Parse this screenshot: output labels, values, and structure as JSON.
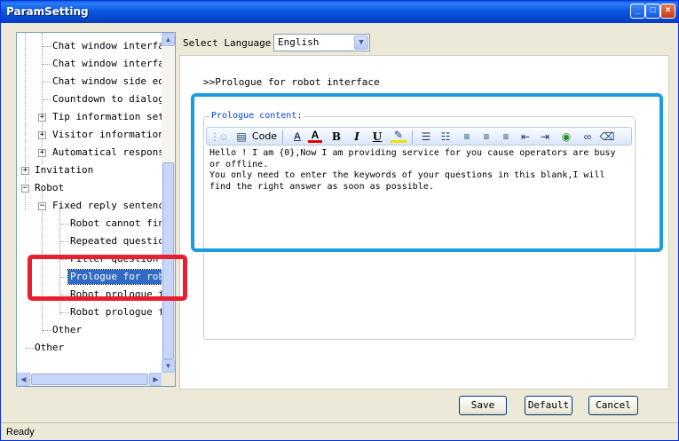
{
  "window": {
    "title": "ParamSetting",
    "buttons": {
      "minimize": "_",
      "maximize": "□",
      "close": "×"
    }
  },
  "tree": {
    "items": [
      {
        "label": "Chat window interface",
        "selected": false
      },
      {
        "label": "Chat window interface",
        "selected": false
      },
      {
        "label": "Chat window side edge",
        "selected": false
      },
      {
        "label": "Countdown to dialog",
        "selected": false
      },
      {
        "label": "Tip information settings",
        "selected": false
      },
      {
        "label": "Visitor information display",
        "selected": false
      },
      {
        "label": "Automatical response",
        "selected": false
      },
      {
        "label": "Invitation",
        "selected": false
      },
      {
        "label": "Robot",
        "selected": false
      },
      {
        "label": "Fixed reply sentences",
        "selected": false
      },
      {
        "label": "Robot cannot find answer",
        "selected": false
      },
      {
        "label": "Repeated question",
        "selected": false
      },
      {
        "label": "Filter question",
        "selected": false
      },
      {
        "label": "Prologue for robot interface",
        "selected": true
      },
      {
        "label": "Robot prologue for",
        "selected": false
      },
      {
        "label": "Robot prologue for",
        "selected": false
      },
      {
        "label": "Other",
        "selected": false
      },
      {
        "label": "Other",
        "selected": false
      }
    ]
  },
  "language": {
    "label": "Select Language",
    "value": "English"
  },
  "section_title": ">>Prologue for robot interface",
  "prologue": {
    "label": "Prologue content:",
    "toolbar": {
      "code_label": "Code",
      "bold": "B",
      "italic": "I",
      "underline": "U"
    },
    "content_line1": "Hello ! I am {0},Now I am providing service for you cause operators are busy or offline.",
    "content_line2": "You only need to enter the keywords of your questions in this blank,I will find the right answer as soon as possible."
  },
  "buttons": {
    "save": "Save",
    "default": "Default",
    "cancel": "Cancel"
  },
  "status": "Ready",
  "colors": {
    "accent": "#0a5fe8",
    "selection": "#316ac5",
    "highlight_blue": "#1a9de0",
    "highlight_red": "#e8202e"
  }
}
